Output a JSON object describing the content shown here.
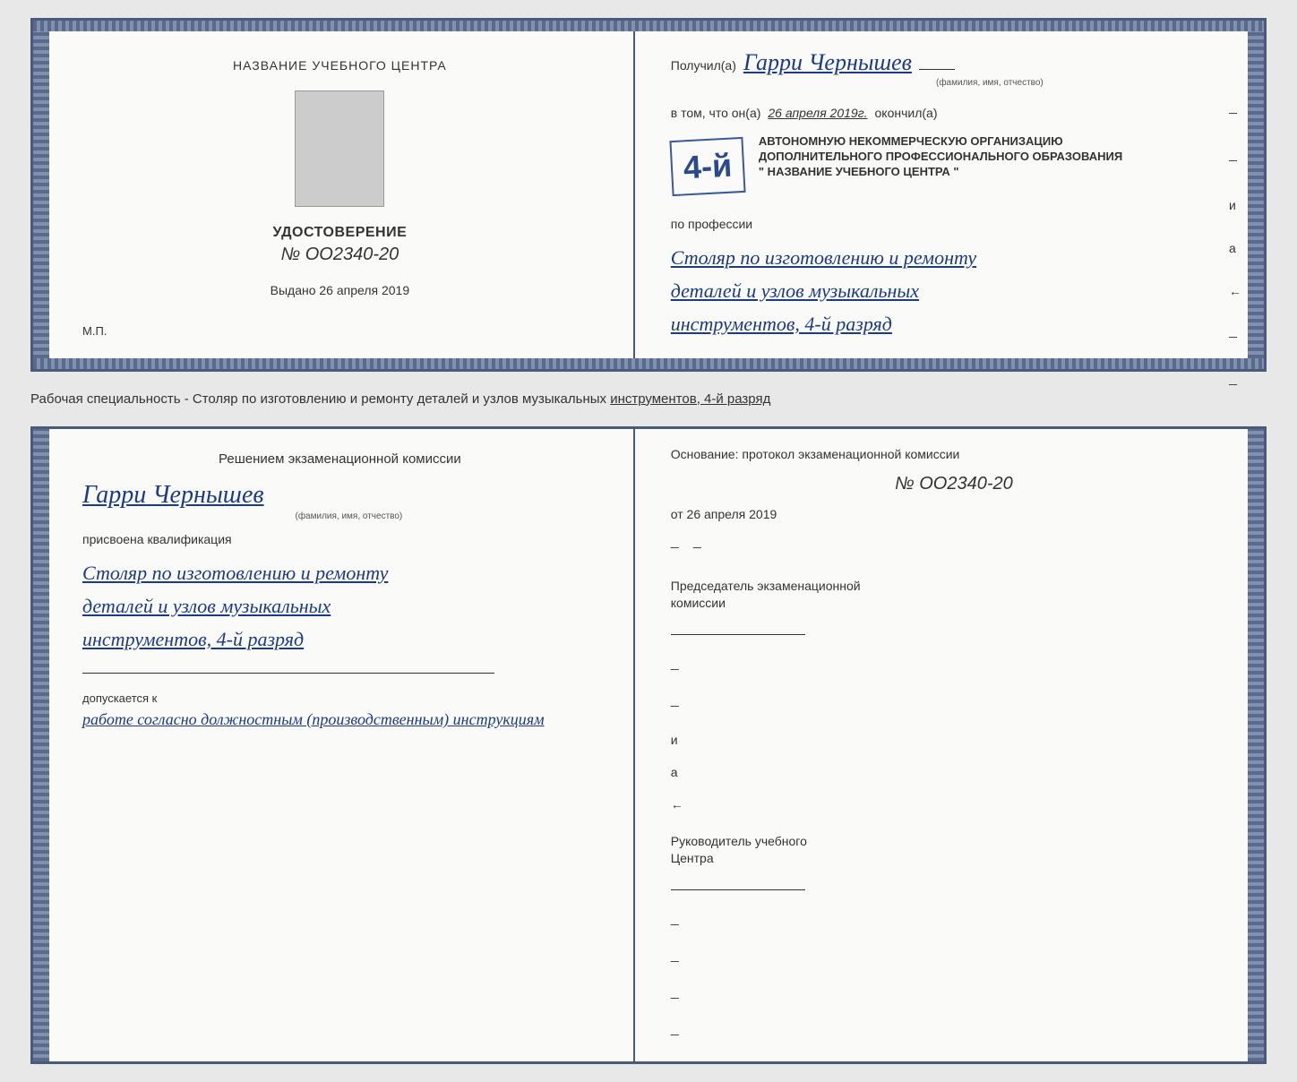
{
  "top_document": {
    "left": {
      "title": "НАЗВАНИЕ УЧЕБНОГО ЦЕНТРА",
      "cert_label": "УДОСТОВЕРЕНИЕ",
      "cert_number": "№ OO2340-20",
      "issued_label": "Выдано",
      "issued_date": "26 апреля 2019",
      "mp_label": "М.П."
    },
    "right": {
      "received_label": "Получил(а)",
      "recipient_name": "Гарри Чернышев",
      "name_subtitle": "(фамилия, имя, отчество)",
      "fact_intro": "в том, что он(а)",
      "fact_date": "26 апреля 2019г.",
      "fact_finished": "окончил(а)",
      "stamp_number": "4-й",
      "stamp_text_1": "АВТОНОМНУЮ НЕКОММЕРЧЕСКУЮ ОРГАНИЗАЦИЮ",
      "stamp_text_2": "ДОПОЛНИТЕЛЬНОГО ПРОФЕССИОНАЛЬНОГО ОБРАЗОВАНИЯ",
      "stamp_text_3": "\" НАЗВАНИЕ УЧЕБНОГО ЦЕНТРА \"",
      "profession_label": "по профессии",
      "profession_line1": "Столяр по изготовлению и ремонту",
      "profession_line2": "деталей и узлов музыкальных",
      "profession_line3": "инструментов, 4-й разряд"
    }
  },
  "between_text": "Рабочая специальность - Столяр по изготовлению и ремонту деталей и узлов музыкальных инструментов, 4-й разряд",
  "bottom_document": {
    "left": {
      "decision_title": "Решением  экзаменационной  комиссии",
      "person_name": "Гарри Чернышев",
      "name_subtitle": "(фамилия, имя, отчество)",
      "assigned_label": "присвоена квалификация",
      "qualification_line1": "Столяр по изготовлению и ремонту",
      "qualification_line2": "деталей и узлов музыкальных",
      "qualification_line3": "инструментов, 4-й разряд",
      "allowed_label": "допускается к",
      "allowed_text": "работе согласно должностным (производственным) инструкциям"
    },
    "right": {
      "basis_label": "Основание: протокол экзаменационной  комиссии",
      "number": "№  OO2340-20",
      "date_prefix": "от",
      "date_value": "26 апреля 2019",
      "chairman_label1": "Председатель экзаменационной",
      "chairman_label2": "комиссии",
      "director_label1": "Руководитель учебного",
      "director_label2": "Центра"
    }
  },
  "colors": {
    "border": "#4a5a7a",
    "handwriting": "#1a3a8a",
    "text": "#333333",
    "stamp": "#2a4a8a",
    "background": "#fafaf8"
  }
}
